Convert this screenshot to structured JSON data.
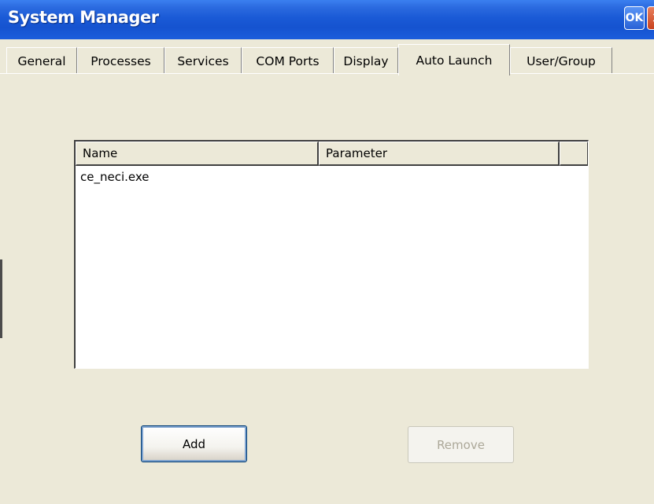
{
  "window": {
    "title": "System Manager",
    "ok_label": "OK",
    "close_symbol": "✕"
  },
  "tabs": [
    {
      "label": "General",
      "active": false
    },
    {
      "label": "Processes",
      "active": false
    },
    {
      "label": "Services",
      "active": false
    },
    {
      "label": "COM Ports",
      "active": false
    },
    {
      "label": "Display",
      "active": false
    },
    {
      "label": "Auto Launch",
      "active": true
    },
    {
      "label": "User/Group",
      "active": false
    }
  ],
  "list": {
    "columns": [
      "Name",
      "Parameter"
    ],
    "rows": [
      {
        "name": "ce_neci.exe",
        "parameter": ""
      }
    ]
  },
  "buttons": {
    "add_label": "Add",
    "remove_label": "Remove",
    "remove_enabled": false
  },
  "colors": {
    "titlebar": "#1553d0",
    "face": "#ece9d8",
    "close": "#c8421e"
  },
  "icons": {
    "ok": "ok-icon",
    "close": "close-icon"
  }
}
